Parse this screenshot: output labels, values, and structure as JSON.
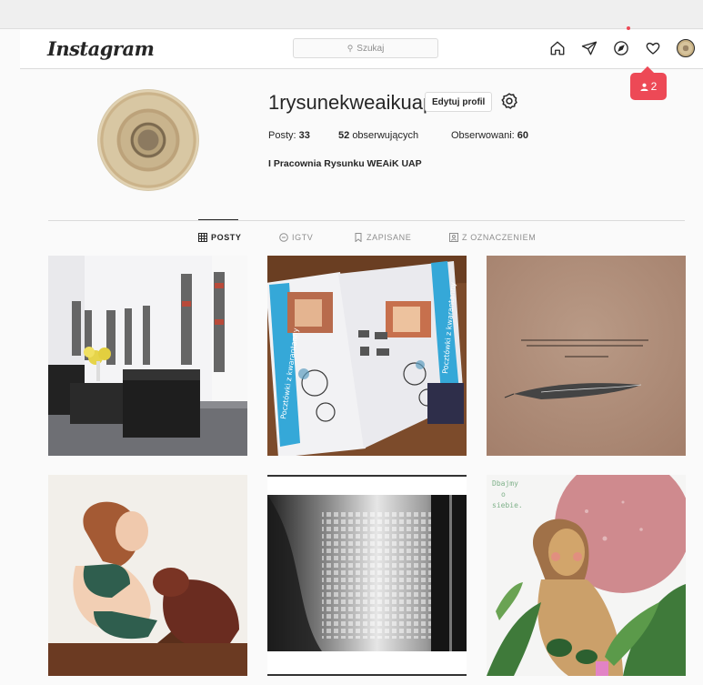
{
  "app": {
    "logo_text": "Instagram"
  },
  "search": {
    "placeholder": "Szukaj"
  },
  "nav": {
    "icons": [
      "home-icon",
      "direct-icon",
      "explore-icon",
      "activity-heart-icon",
      "profile-avatar"
    ]
  },
  "notification": {
    "count": "2",
    "color": "#ed4956"
  },
  "profile": {
    "username": "1rysunekweaikuap",
    "edit_label": "Edytuj profil",
    "posts_label": "Posty:",
    "posts_count": "33",
    "followers_count": "52",
    "followers_label": "obserwujących",
    "following_label": "Obserwowani:",
    "following_count": "60",
    "bio": "I Pracownia Rysunku WEAiK UAP"
  },
  "tabs": [
    {
      "label": "POSTY",
      "icon": "grid-icon",
      "active": true
    },
    {
      "label": "IGTV",
      "icon": "igtv-icon",
      "active": false
    },
    {
      "label": "ZAPISANE",
      "icon": "bookmark-icon",
      "active": false
    },
    {
      "label": "Z OZNACZENIEM",
      "icon": "tag-icon",
      "active": false
    }
  ],
  "posts": {
    "post2_text": "Pocztówki z kwarantanny",
    "post6_text_line1": "Dbajmy",
    "post6_text_line2": "o",
    "post6_text_line3": "siebie."
  }
}
